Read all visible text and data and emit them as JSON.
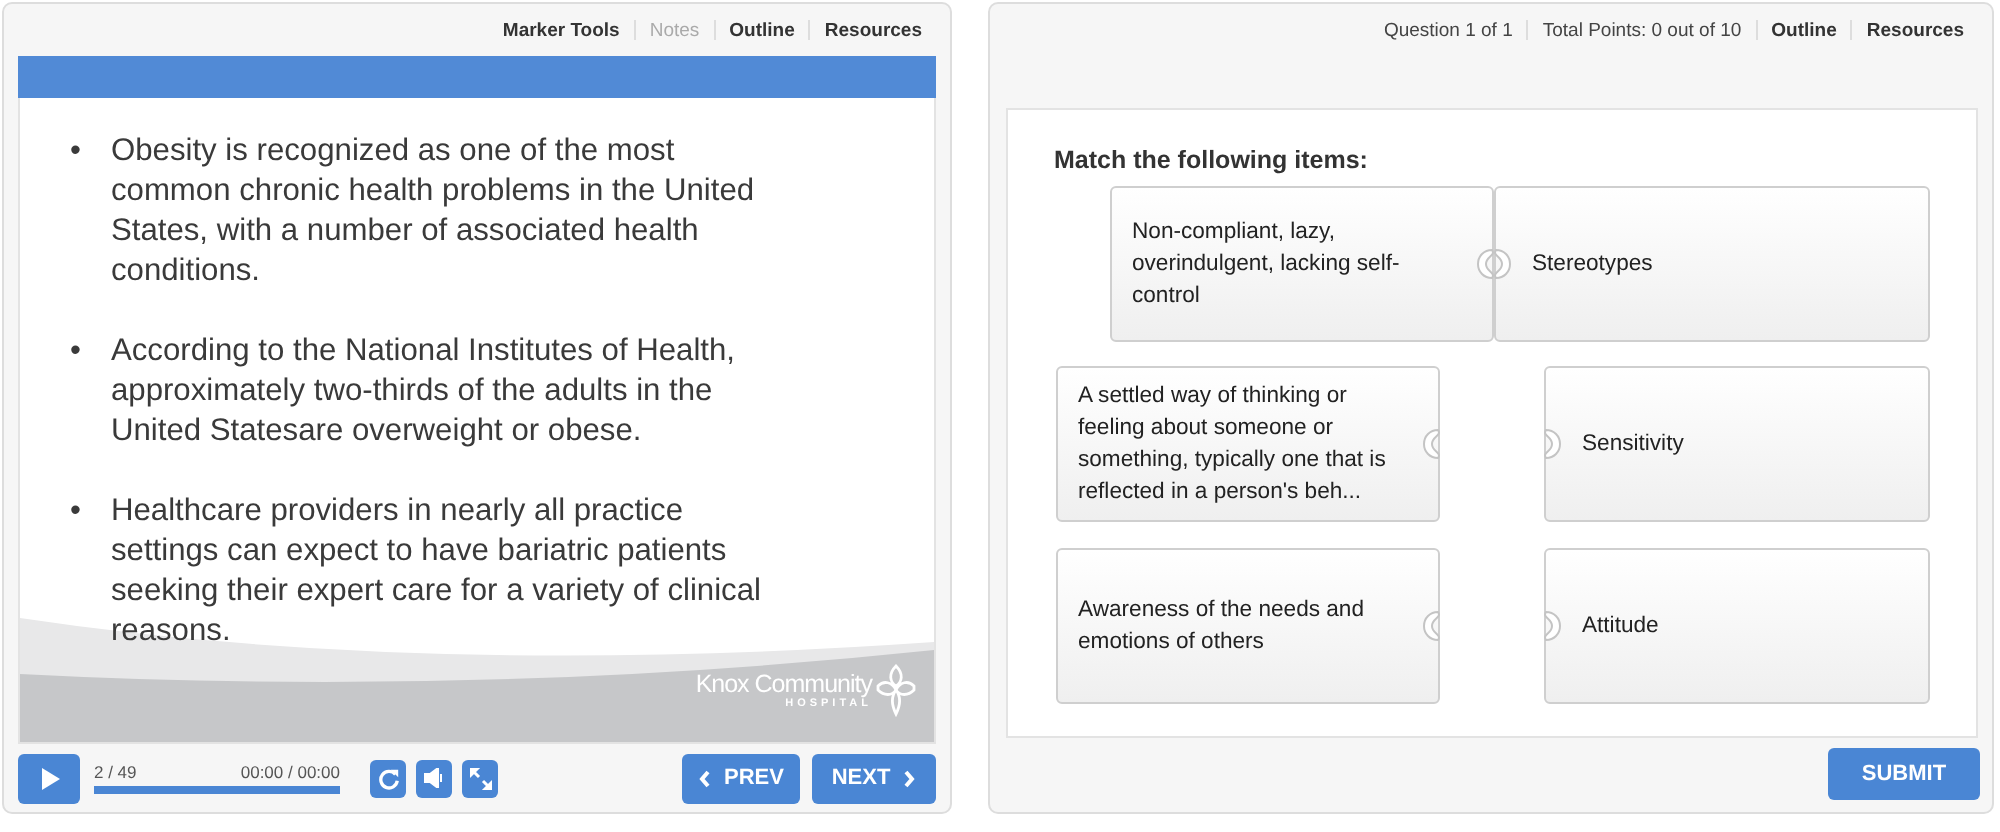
{
  "player": {
    "links": [
      {
        "label": "Marker Tools",
        "disabled": false
      },
      {
        "label": "Notes",
        "disabled": true
      },
      {
        "label": "Outline",
        "disabled": false
      },
      {
        "label": "Resources",
        "disabled": false
      }
    ],
    "bullets": [
      {
        "marker": "•",
        "text": "Obesity is recognized as one of the most common chronic health problems in the United States, with a number of associated health conditions."
      },
      {
        "marker": "•",
        "text": "According to the National Institutes of Health, approximately two-thirds of the adults in the United Statesare overweight or obese."
      },
      {
        "marker": "•",
        "text": "Healthcare providers in nearly all practice settings can expect to have bariatric patients seeking their expert care for a variety of clinical reasons."
      }
    ],
    "logo": {
      "name": "Knox Community",
      "subtitle": "HOSPITAL"
    },
    "controls": {
      "slide_counter": "2 / 49",
      "time": "00:00 / 00:00",
      "level": 1,
      "prev": "PREV",
      "next": "NEXT"
    }
  },
  "quiz": {
    "header": [
      {
        "label": "Question 1 of 1",
        "kind": "info"
      },
      {
        "label": "Total Points: 0 out of 10",
        "kind": "info"
      },
      {
        "label": "Outline",
        "kind": "link"
      },
      {
        "label": "Resources",
        "kind": "link"
      }
    ],
    "prompt": "Match the following items:",
    "pairs": [
      {
        "left": "Non-compliant, lazy, overindulgent, lacking self-control",
        "right": "Stereotypes",
        "matched": true
      },
      {
        "left": "A settled way of thinking or feeling about someone or something, typically one that is reflected in a person's beh...",
        "right": "Sensitivity",
        "matched": false
      },
      {
        "left": "Awareness of the needs and emotions of others",
        "right": "Attitude",
        "matched": false
      }
    ],
    "submit": "SUBMIT"
  }
}
